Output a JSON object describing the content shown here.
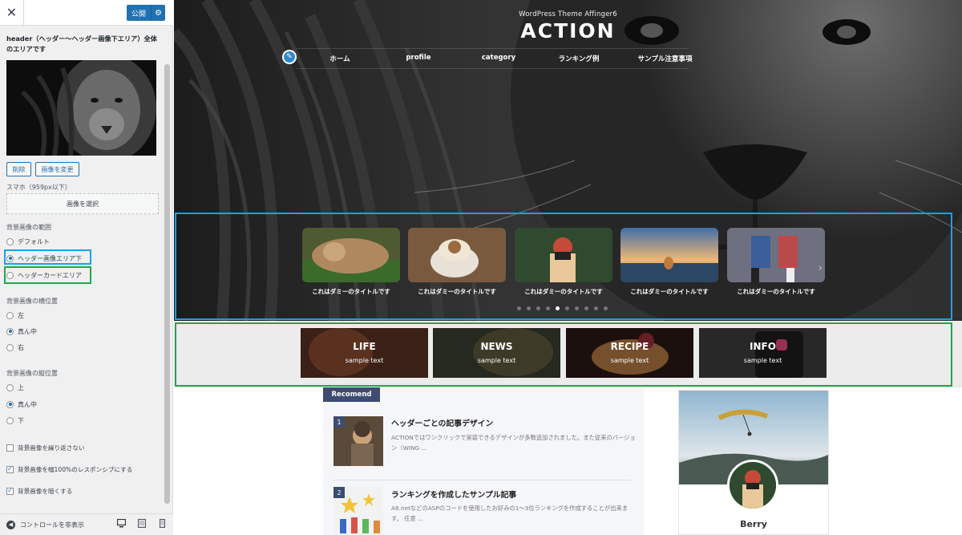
{
  "customizer": {
    "publish_label": "公開",
    "description": "header（ヘッダー〜ヘッダー画像下エリア）全体のエリアです",
    "remove_label": "削除",
    "change_image_label": "画像を変更",
    "smartphone_label": "スマホ（959px以下）",
    "select_image_label": "画像を選択",
    "range": {
      "heading": "背景画像の範囲",
      "options": [
        "デフォルト",
        "ヘッダー画像エリア下",
        "ヘッダーカードエリア"
      ],
      "selected": "ヘッダー画像エリア下"
    },
    "horizontal": {
      "heading": "背景画像の横位置",
      "options": [
        "左",
        "真ん中",
        "右"
      ],
      "selected": "真ん中"
    },
    "vertical": {
      "heading": "背景画像の縦位置",
      "options": [
        "上",
        "真ん中",
        "下"
      ],
      "selected": "真ん中"
    },
    "checkboxes": [
      {
        "label": "背景画像を繰り返さない",
        "checked": false
      },
      {
        "label": "背景画像を幅100%のレスポンシブにする",
        "checked": true
      },
      {
        "label": "背景画像を暗くする",
        "checked": true
      }
    ],
    "hide_controls_label": "コントロールを非表示",
    "accent_color": "#2271b1",
    "highlight_blue": "#1ba1e2",
    "highlight_green": "#1fa64a"
  },
  "site": {
    "tagline": "WordPress Theme Affinger6",
    "title": "ACTION",
    "nav": [
      "ホーム",
      "profile",
      "category",
      "ランキング例",
      "サンプル注意事項"
    ],
    "slides": [
      {
        "caption": "これはダミーのタイトルです"
      },
      {
        "caption": "これはダミーのタイトルです"
      },
      {
        "caption": "これはダミーのタイトルです"
      },
      {
        "caption": "これはダミーのタイトルです"
      },
      {
        "caption": "これはダミーのタイトルです"
      }
    ],
    "slider_dots": 10,
    "slider_active_dot": 4,
    "cards": [
      {
        "title": "LIFE",
        "sub": "sample text"
      },
      {
        "title": "NEWS",
        "sub": "sample text"
      },
      {
        "title": "RECIPE",
        "sub": "sample text"
      },
      {
        "title": "INFO",
        "sub": "sample text"
      }
    ],
    "recomend_label": "Recomend",
    "articles": [
      {
        "num": "1",
        "title": "ヘッダーごとの記事デザイン",
        "excerpt": "ACTIONではワンクリックで実装できるデザインが多数追加されました。また従来のバージョン（WING ..."
      },
      {
        "num": "2",
        "title": "ランキングを作成したサンプル記事",
        "excerpt": "A8.netなどのASPのコードを使用したお好みの1〜3位ランキングを作成することが出来ます。 任意 ..."
      }
    ],
    "profile_name": "Berry",
    "tab_color": "#3c4d6f"
  }
}
